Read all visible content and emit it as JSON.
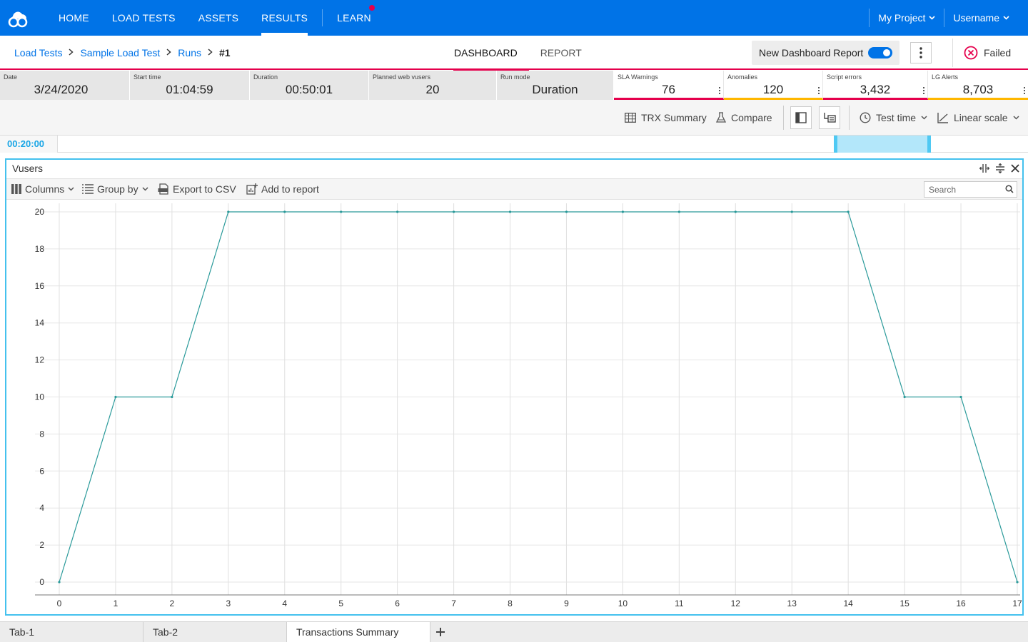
{
  "nav": {
    "items": [
      {
        "label": "HOME",
        "active": false
      },
      {
        "label": "LOAD TESTS",
        "active": false
      },
      {
        "label": "ASSETS",
        "active": false
      },
      {
        "label": "RESULTS",
        "active": true
      },
      {
        "label": "LEARN",
        "active": false
      }
    ],
    "project": "My Project",
    "user": "Username"
  },
  "breadcrumb": [
    "Load Tests",
    "Sample Load Test",
    "Runs",
    "#1"
  ],
  "view_tabs": {
    "dashboard": "DASHBOARD",
    "report": "REPORT"
  },
  "report_toggle": {
    "label": "New Dashboard Report",
    "on": true
  },
  "status": "Failed",
  "kpis": {
    "date": {
      "label": "Date",
      "value": "3/24/2020"
    },
    "start_time": {
      "label": "Start time",
      "value": "01:04:59"
    },
    "duration": {
      "label": "Duration",
      "value": "00:50:01"
    },
    "vusers": {
      "label": "Planned web vusers",
      "value": "20"
    },
    "run_mode": {
      "label": "Run mode",
      "value": "Duration"
    },
    "sla": {
      "label": "SLA Warnings",
      "value": "76"
    },
    "anomalies": {
      "label": "Anomalies",
      "value": "120"
    },
    "script_errors": {
      "label": "Script errors",
      "value": "3,432"
    },
    "lg_alerts": {
      "label": "LG Alerts",
      "value": "8,703"
    }
  },
  "toolbar": {
    "trx_summary": "TRX Summary",
    "compare": "Compare",
    "test_time": "Test time",
    "linear_scale": "Linear scale"
  },
  "timeline": {
    "time": "00:20:00"
  },
  "panel": {
    "title": "Vusers",
    "columns": "Columns",
    "group_by": "Group by",
    "export": "Export to CSV",
    "add_report": "Add to report",
    "search_placeholder": "Search"
  },
  "bottom_tabs": [
    "Tab-1",
    "Tab-2",
    "Transactions Summary"
  ],
  "colors": {
    "primary": "#0073e7",
    "accent": "#e5004c",
    "warning": "#ffb700",
    "line": "#2a9a9a",
    "panel_border": "#44c1ee"
  },
  "chart_data": {
    "type": "line",
    "x": [
      0,
      1,
      2,
      3,
      4,
      5,
      6,
      7,
      8,
      9,
      10,
      11,
      12,
      13,
      14,
      15,
      16,
      17
    ],
    "series": [
      {
        "values": [
          0,
          10,
          10,
          20,
          20,
          20,
          20,
          20,
          20,
          20,
          20,
          20,
          20,
          20,
          20,
          10,
          10,
          0
        ]
      }
    ],
    "xlim": [
      0,
      17
    ],
    "ylim": [
      0,
      20
    ],
    "x_ticks": [
      "0",
      "1",
      "2",
      "3",
      "4",
      "5",
      "6",
      "7",
      "8",
      "9",
      "10",
      "11",
      "12",
      "13",
      "14",
      "15",
      "16",
      "17"
    ],
    "y_ticks": [
      "0",
      "2",
      "4",
      "6",
      "8",
      "10",
      "12",
      "14",
      "16",
      "18",
      "20"
    ],
    "grid": true,
    "title": "",
    "xlabel": "",
    "ylabel": ""
  }
}
